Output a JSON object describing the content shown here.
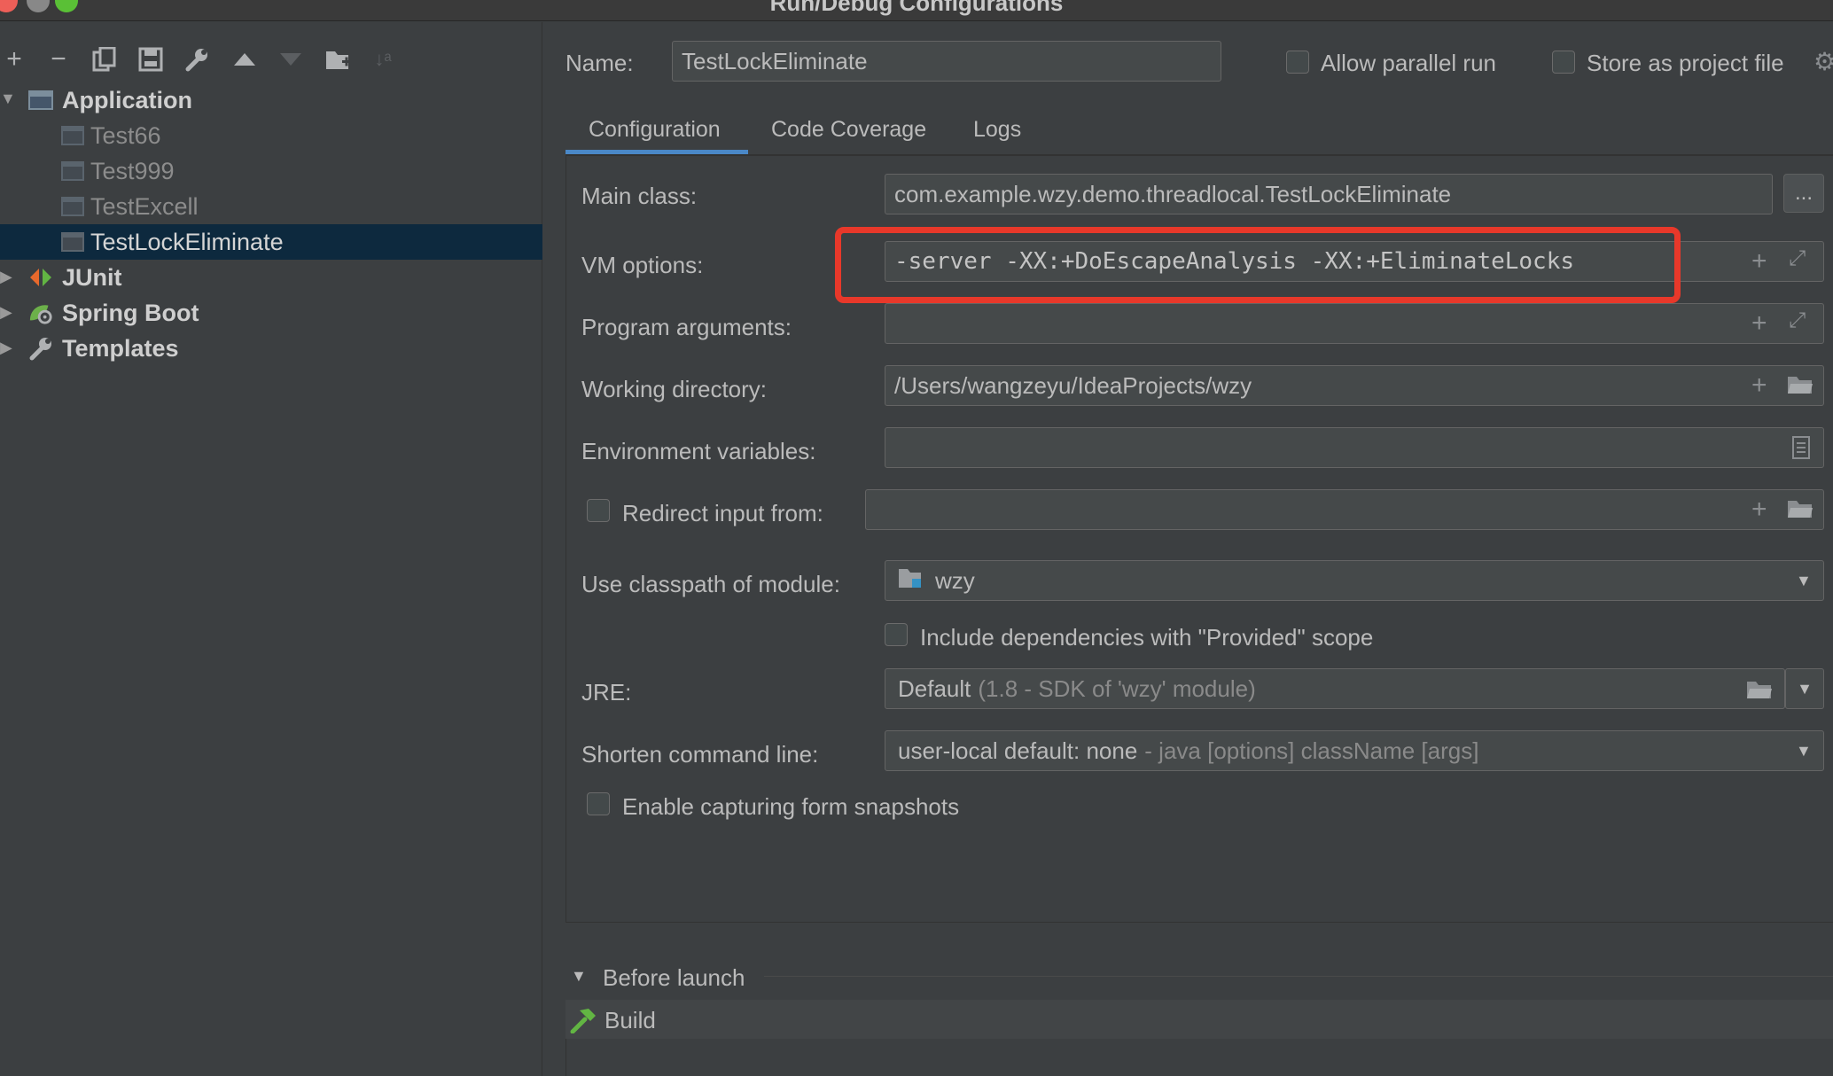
{
  "window": {
    "title": "Run/Debug Configurations"
  },
  "toolbar": {
    "icons": [
      "add-icon",
      "remove-icon",
      "copy-icon",
      "save-icon",
      "wrench-icon",
      "move-up-icon",
      "move-down-icon",
      "new-folder-icon",
      "sort-icon"
    ]
  },
  "tree": {
    "application": {
      "label": "Application",
      "items": [
        {
          "label": "Test66"
        },
        {
          "label": "Test999"
        },
        {
          "label": "TestExcell"
        },
        {
          "label": "TestLockEliminate",
          "selected": true
        }
      ]
    },
    "junit": {
      "label": "JUnit"
    },
    "spring_boot": {
      "label": "Spring Boot"
    },
    "templates": {
      "label": "Templates"
    }
  },
  "header": {
    "name_label": "Name:",
    "name_value": "TestLockEliminate",
    "allow_parallel_label": "Allow parallel run",
    "allow_parallel_checked": false,
    "store_project_label": "Store as project file",
    "store_project_checked": false
  },
  "tabs": [
    {
      "label": "Configuration",
      "active": true
    },
    {
      "label": "Code Coverage",
      "active": false
    },
    {
      "label": "Logs",
      "active": false
    }
  ],
  "form": {
    "main_class_label": "Main class:",
    "main_class_value": "com.example.wzy.demo.threadlocal.TestLockEliminate",
    "main_class_button": "...",
    "vm_options_label": "VM options:",
    "vm_options_value": "-server -XX:+DoEscapeAnalysis -XX:+EliminateLocks",
    "program_args_label": "Program arguments:",
    "program_args_value": "",
    "working_dir_label": "Working directory:",
    "working_dir_value": "/Users/wangzeyu/IdeaProjects/wzy",
    "env_vars_label": "Environment variables:",
    "env_vars_value": "",
    "redirect_label": "Redirect input from:",
    "redirect_checked": false,
    "redirect_value": "",
    "classpath_label": "Use classpath of module:",
    "classpath_value": "wzy",
    "include_deps_label": "Include dependencies with \"Provided\" scope",
    "include_deps_checked": false,
    "jre_label": "JRE:",
    "jre_value": "Default",
    "jre_hint": "(1.8 - SDK of 'wzy' module)",
    "shorten_label": "Shorten command line:",
    "shorten_value": "user-local default: none",
    "shorten_hint": "- java [options] className [args]",
    "snapshots_label": "Enable capturing form snapshots",
    "snapshots_checked": false
  },
  "before_launch": {
    "label": "Before launch",
    "tasks": [
      {
        "label": "Build",
        "icon": "hammer-icon"
      }
    ]
  },
  "colors": {
    "background": "#3c3f41",
    "selection": "#0d293e",
    "field_bg": "#45494a",
    "accent_tab": "#4a88c7",
    "highlight_box": "#e8382a"
  }
}
